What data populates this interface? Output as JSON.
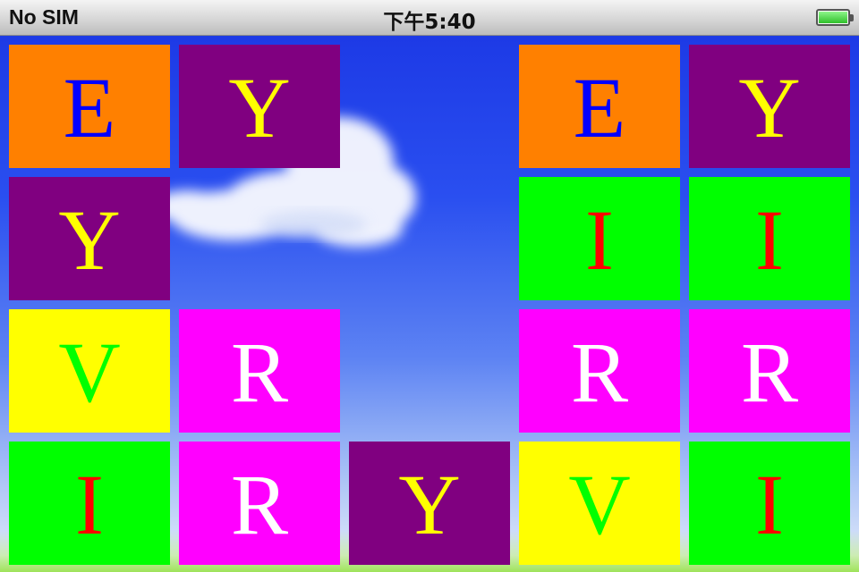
{
  "status_bar": {
    "carrier": "No SIM",
    "time": "下午5:40",
    "battery_level": 1.0,
    "battery_icon": "battery-full-icon"
  },
  "board": {
    "columns": 5,
    "rows": 4,
    "colors": {
      "orange": "#ff8000",
      "purple": "#800080",
      "green": "#00ff00",
      "yellow": "#ffff00",
      "magenta": "#ff00ff",
      "blue": "#0000ff",
      "red": "#ff0000",
      "white": "#ffffff"
    },
    "cards": [
      {
        "row": 0,
        "col": 0,
        "letter": "E",
        "bg": "#ff8000",
        "fg": "#0000ff"
      },
      {
        "row": 0,
        "col": 1,
        "letter": "Y",
        "bg": "#800080",
        "fg": "#ffff00"
      },
      {
        "row": 0,
        "col": 3,
        "letter": "E",
        "bg": "#ff8000",
        "fg": "#0000ff"
      },
      {
        "row": 0,
        "col": 4,
        "letter": "Y",
        "bg": "#800080",
        "fg": "#ffff00"
      },
      {
        "row": 1,
        "col": 0,
        "letter": "Y",
        "bg": "#800080",
        "fg": "#ffff00"
      },
      {
        "row": 1,
        "col": 3,
        "letter": "I",
        "bg": "#00ff00",
        "fg": "#ff0000"
      },
      {
        "row": 1,
        "col": 4,
        "letter": "I",
        "bg": "#00ff00",
        "fg": "#ff0000"
      },
      {
        "row": 2,
        "col": 0,
        "letter": "V",
        "bg": "#ffff00",
        "fg": "#00ff00"
      },
      {
        "row": 2,
        "col": 1,
        "letter": "R",
        "bg": "#ff00ff",
        "fg": "#ffffff"
      },
      {
        "row": 2,
        "col": 3,
        "letter": "R",
        "bg": "#ff00ff",
        "fg": "#ffffff"
      },
      {
        "row": 2,
        "col": 4,
        "letter": "R",
        "bg": "#ff00ff",
        "fg": "#ffffff"
      },
      {
        "row": 3,
        "col": 0,
        "letter": "I",
        "bg": "#00ff00",
        "fg": "#ff0000"
      },
      {
        "row": 3,
        "col": 1,
        "letter": "R",
        "bg": "#ff00ff",
        "fg": "#ffffff"
      },
      {
        "row": 3,
        "col": 2,
        "letter": "Y",
        "bg": "#800080",
        "fg": "#ffff00"
      },
      {
        "row": 3,
        "col": 3,
        "letter": "V",
        "bg": "#ffff00",
        "fg": "#00ff00"
      },
      {
        "row": 3,
        "col": 4,
        "letter": "I",
        "bg": "#00ff00",
        "fg": "#ff0000"
      }
    ]
  }
}
